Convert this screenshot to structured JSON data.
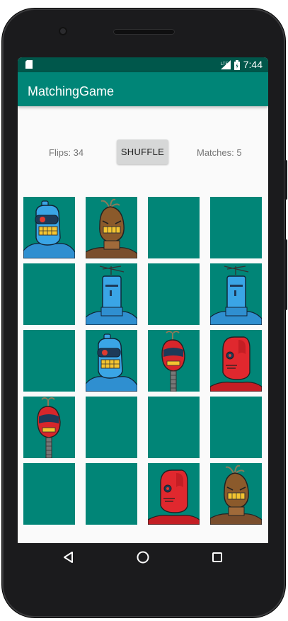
{
  "status_bar": {
    "time": "7:44",
    "network": "LTE"
  },
  "app_bar": {
    "title": "MatchingGame"
  },
  "controls": {
    "flips": "Flips: 34",
    "shuffle_label": "SHUFFLE",
    "matches": "Matches: 5"
  },
  "colors": {
    "card_back": "#018577",
    "app_bar": "#008577",
    "status_bar": "#00574b",
    "button": "#d6d7d7"
  },
  "cards": [
    {
      "face": "blue-visor-robot"
    },
    {
      "face": "brown-sack-robot"
    },
    {
      "face": "hidden"
    },
    {
      "face": "hidden"
    },
    {
      "face": "hidden"
    },
    {
      "face": "blue-antenna-robot"
    },
    {
      "face": "hidden"
    },
    {
      "face": "blue-antenna-robot"
    },
    {
      "face": "hidden"
    },
    {
      "face": "blue-visor-robot"
    },
    {
      "face": "red-sprout-robot"
    },
    {
      "face": "red-hood-robot"
    },
    {
      "face": "red-sprout-robot"
    },
    {
      "face": "hidden"
    },
    {
      "face": "hidden"
    },
    {
      "face": "hidden"
    },
    {
      "face": "hidden"
    },
    {
      "face": "hidden"
    },
    {
      "face": "red-hood-robot"
    },
    {
      "face": "brown-sack-robot"
    }
  ],
  "nav": {
    "back_icon": "back-triangle-icon",
    "home_icon": "home-circle-icon",
    "recents_icon": "recents-square-icon"
  }
}
